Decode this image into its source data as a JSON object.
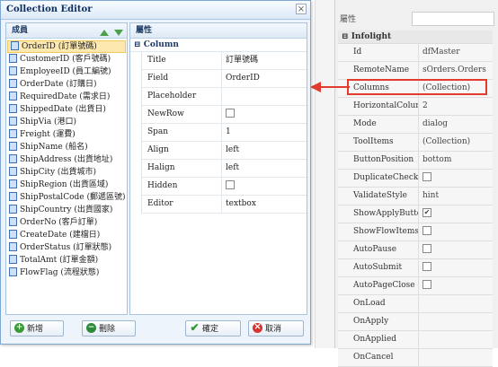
{
  "designer": {
    "header_label": "屬性",
    "group": "Infolight",
    "properties": [
      {
        "name": "Id",
        "value": "dfMaster"
      },
      {
        "name": "RemoteName",
        "value": "sOrders.Orders"
      },
      {
        "name": "Columns",
        "value": "(Collection)"
      },
      {
        "name": "HorizontalColumn",
        "value": "2"
      },
      {
        "name": "Mode",
        "value": "dialog"
      },
      {
        "name": "ToolItems",
        "value": "(Collection)"
      },
      {
        "name": "ButtonPosition",
        "value": "bottom"
      },
      {
        "name": "DuplicateCheck",
        "value": "",
        "check": ""
      },
      {
        "name": "ValidateStyle",
        "value": "hint"
      },
      {
        "name": "ShowApplyButton",
        "value": "",
        "check": "✔"
      },
      {
        "name": "ShowFlowItems",
        "value": "",
        "check": ""
      },
      {
        "name": "AutoPause",
        "value": "",
        "check": ""
      },
      {
        "name": "AutoSubmit",
        "value": "",
        "check": ""
      },
      {
        "name": "AutoPageClose",
        "value": "",
        "check": ""
      },
      {
        "name": "OnLoad",
        "value": ""
      },
      {
        "name": "OnApply",
        "value": ""
      },
      {
        "name": "OnApplied",
        "value": ""
      },
      {
        "name": "OnCancel",
        "value": ""
      }
    ]
  },
  "dialog": {
    "title": "Collection Editor",
    "close_glyph": "×",
    "members_label": "成員",
    "properties_label": "屬性",
    "members": [
      "OrderID (訂單號碼)",
      "CustomerID (客戶號碼)",
      "EmployeeID (員工編號)",
      "OrderDate (訂購日)",
      "RequiredDate (需求日)",
      "ShippedDate (出貨日)",
      "ShipVia (港口)",
      "Freight (運費)",
      "ShipName (船名)",
      "ShipAddress (出貨地址)",
      "ShipCity (出貨城市)",
      "ShipRegion (出貨區域)",
      "ShipPostalCode (郵遞區號)",
      "ShipCountry (出貨國家)",
      "OrderNo (客戶訂單)",
      "CreateDate (建檔日)",
      "OrderStatus (訂單狀態)",
      "TotalAmt (訂單金額)",
      "FlowFlag (流程狀態)"
    ],
    "selected_index": 0,
    "prop_group": "Column",
    "props": [
      {
        "name": "Title",
        "value": "訂單號碼"
      },
      {
        "name": "Field",
        "value": "OrderID"
      },
      {
        "name": "Placeholder",
        "value": ""
      },
      {
        "name": "NewRow",
        "value": "",
        "check": ""
      },
      {
        "name": "Span",
        "value": "1"
      },
      {
        "name": "Align",
        "value": "left"
      },
      {
        "name": "Halign",
        "value": "left"
      },
      {
        "name": "Hidden",
        "value": "",
        "check": ""
      },
      {
        "name": "Editor",
        "value": "textbox"
      }
    ],
    "buttons": {
      "add": "新增",
      "delete": "刪除",
      "ok": "確定",
      "cancel": "取消"
    }
  },
  "colors": {
    "highlight": "#e23c2c",
    "selected_row": "#fde9b0",
    "sort_arrows": "#4da04a"
  }
}
